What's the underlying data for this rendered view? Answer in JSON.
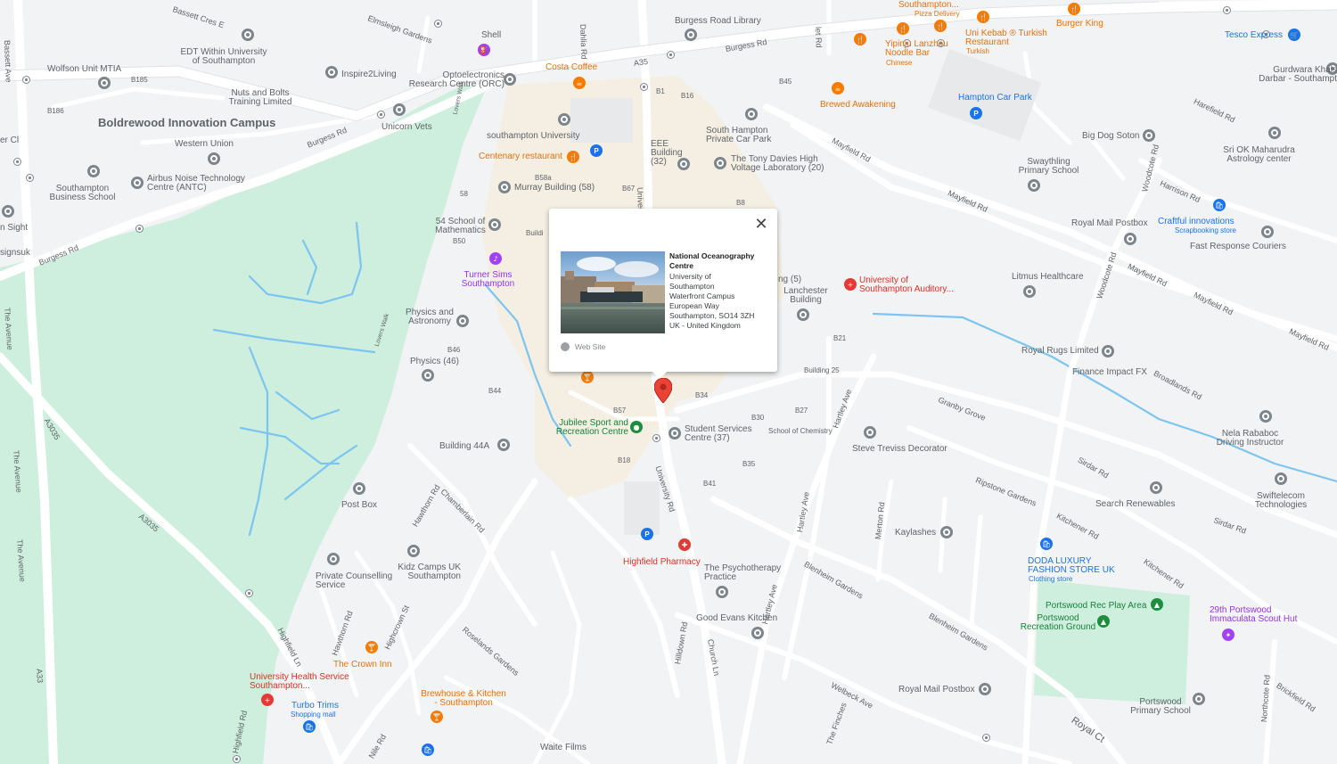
{
  "popup": {
    "title": "National Oceanography Centre",
    "address_lines": [
      "University of",
      "Southampton",
      "Waterfront Campus",
      "European Way",
      "Southampton, SO14 3ZH",
      "UK - United Kingdom"
    ],
    "website_label": "Web Site",
    "close_glyph": "✕"
  },
  "places": {
    "boldrewood": "Boldrewood Innovation Campus",
    "wolfson": "Wolfson Unit MTIA",
    "edt": "EDT Within University of Southampton",
    "nuts_bolts": "Nuts and Bolts Training Limited",
    "western_union": "Western Union",
    "inspire": "Inspire2Living",
    "opto": "Optoelectronics Research Centre (ORC)",
    "unicorn": "Unicorn Vets",
    "airbus": "Airbus Noise Technology Centre (ANTC)",
    "sbs": "Southampton Business School",
    "shell": "Shell",
    "costa": "Costa Coffee",
    "burgess_library": "Burgess Road Library",
    "soton_uni": "southampton University",
    "centenary": "Centenary restaurant",
    "eee": "EEE Building (32)",
    "south_hampton_cp": "South Hampton Private Car Park",
    "tony_davies": "The Tony Davies High Voltage Laboratory (20)",
    "murray": "Murray Building (58)",
    "maths": "54 School of Mathematics",
    "turner": "Turner Sims Southampton",
    "physics_astro": "Physics and Astronomy",
    "physics46": "Physics (46)",
    "lanchester": "Lanchester Building",
    "aud": "University of Southampton Auditory...",
    "jubilee": "Jubilee Sport and Recreation Centre",
    "student_services": "Student Services Centre (37)",
    "building44a": "Building 44A",
    "school_chem": "School of Chemistry",
    "steve": "Steve Treviss Decorator",
    "building25": "Building 25",
    "post_box": "Post Box",
    "kidz": "Kidz Camps UK Southampton",
    "private_counselling": "Private Counselling Service",
    "highfield_pharmacy": "Highfield Pharmacy",
    "psychotherapy": "The Psychotherapy Practice",
    "good_evans": "Good Evans Kitchen",
    "crown_inn": "The Crown Inn",
    "uhs": "University Health Service Southampton...",
    "turbo": "Turbo Trims",
    "turbo_sub": "Shopping mall",
    "brewhouse": "Brewhouse & Kitchen - Southampton",
    "waite": "Waite Films",
    "kaylashes": "Kaylashes",
    "royal_postbox": "Royal Mail Postbox",
    "royal_postbox2": "Royal Mail Postbox",
    "doda": "DODA LUXURY FASHION STORE UK",
    "doda_sub": "Clothing store",
    "portswood_play": "Portswood Rec Play Area",
    "portswood_rec": "Portswood Recreation Ground",
    "portswood_school": "Portswood Primary School",
    "scout": "29th Portswood Immaculata Scout Hut",
    "search_renew": "Search Renewables",
    "swiftelecom": "Swiftelecom Technologies",
    "nela": "Nela Rababoc Driving Instructor",
    "royal_rugs": "Royal Rugs Limited",
    "finance": "Finance Impact FX",
    "litmus": "Litmus Healthcare",
    "fast_response": "Fast Response Couriers",
    "craftful": "Craftful innovations",
    "craftful_sub": "Scrapbooking store",
    "big_dog": "Big Dog Soton",
    "sri": "Sri OK Maharudra Astrology center",
    "swaythling": "Swaythling Primary School",
    "hampton_cp": "Hampton Car Park",
    "brewed": "Brewed Awakening",
    "yipinju": "Yipinju Lanzhou Noodle Bar",
    "yipinju_sub": "Chinese",
    "uni_kebab": "Uni Kebab ® Turkish Restaurant",
    "uni_kebab_sub": "Turkish",
    "soton_pizza": "Southampton...",
    "soton_pizza_sub": "Pizza Delivery",
    "burger_king": "Burger King",
    "tesco": "Tesco Express",
    "gurdwara": "Gurdwara Khals Darbar - Southampt",
    "sight": "n Sight",
    "signsuk": "signsuk",
    "cl": "er Cl"
  },
  "roads": {
    "bassett_cres": "Bassett Cres E",
    "bassett_ave": "Bassett Ave",
    "elmsleigh": "Elmsleigh Gardens",
    "dahlia": "Dahlia Rd",
    "burgess1": "Burgess Rd",
    "burgess2": "Burgess Rd",
    "burgess3": "Burgess Rd",
    "a35": "A35",
    "the_avenue1": "The Avenue",
    "the_avenue2": "The Avenue",
    "the_avenue3": "The Avenue",
    "a3035a": "A3035",
    "a3035b": "A3035",
    "a33": "A33",
    "lovers_walk": "Lovers Walk",
    "lovers_walk2": "Lovers Walk",
    "chamberlain": "Chamberlain Rd",
    "hawthorn": "Hawthorn Rd",
    "hawthorn2": "Hawthorn Rd",
    "highcrown": "Highcrown St",
    "roselands": "Roselands Gardens",
    "highfield_ln": "Highfield Ln",
    "highfield_rd": "Highfield Rd",
    "university_rd": "University Rd",
    "university2": "Univer",
    "hilldown": "Hilldown Rd",
    "church_ln": "Church Ln",
    "hartley1": "Hartley Ave",
    "hartley2": "Hartley Ave",
    "hartley3": "Hartley Ave",
    "merton": "Merton Rd",
    "blenheim1": "Blenheim Gardens",
    "blenheim2": "Blenheim Gardens",
    "welbeck": "Welbeck Ave",
    "the_finches": "The Finches",
    "ripstone": "Ripstone Gardens",
    "kitchener1": "Kitchener Rd",
    "kitchener2": "Kitchener Rd",
    "granby": "Granby Grove",
    "broadlands": "Broadlands Rd",
    "sirdar1": "Sirdar Rd",
    "sirdar2": "Sirdar Rd",
    "mayfield1": "Mayfield Rd",
    "mayfield2": "Mayfield Rd",
    "mayfield3": "Mayfield Rd",
    "mayfield4": "Mayfield Rd",
    "mayfield5": "Mayfield Rd",
    "woodcote1": "Woodcote Rd",
    "woodcote2": "Woodcote Rd",
    "harrison": "Harrison Rd",
    "harefield": "Harefield Rd",
    "brickfield": "Brickfield Rd",
    "northcote": "Northcote Rd",
    "royal_ct": "Royal Ct",
    "nile": "Nile Rd",
    "let_rd": "let Rd"
  },
  "building_codes": [
    "B185",
    "B186",
    "B1",
    "B16",
    "B45",
    "B58a",
    "B67",
    "B8",
    "58",
    "B50",
    "B46",
    "B44",
    "B57",
    "B34",
    "B30",
    "B27",
    "B21",
    "B18",
    "B35",
    "B41",
    "Buildi",
    "ng (5)"
  ],
  "colors": {
    "land": "#f2f3f4",
    "park": "#ceefdd",
    "road": "#ffffff",
    "water": "#7cc5f0",
    "campus": "#f6ecdb",
    "marker": "#ea4335"
  }
}
